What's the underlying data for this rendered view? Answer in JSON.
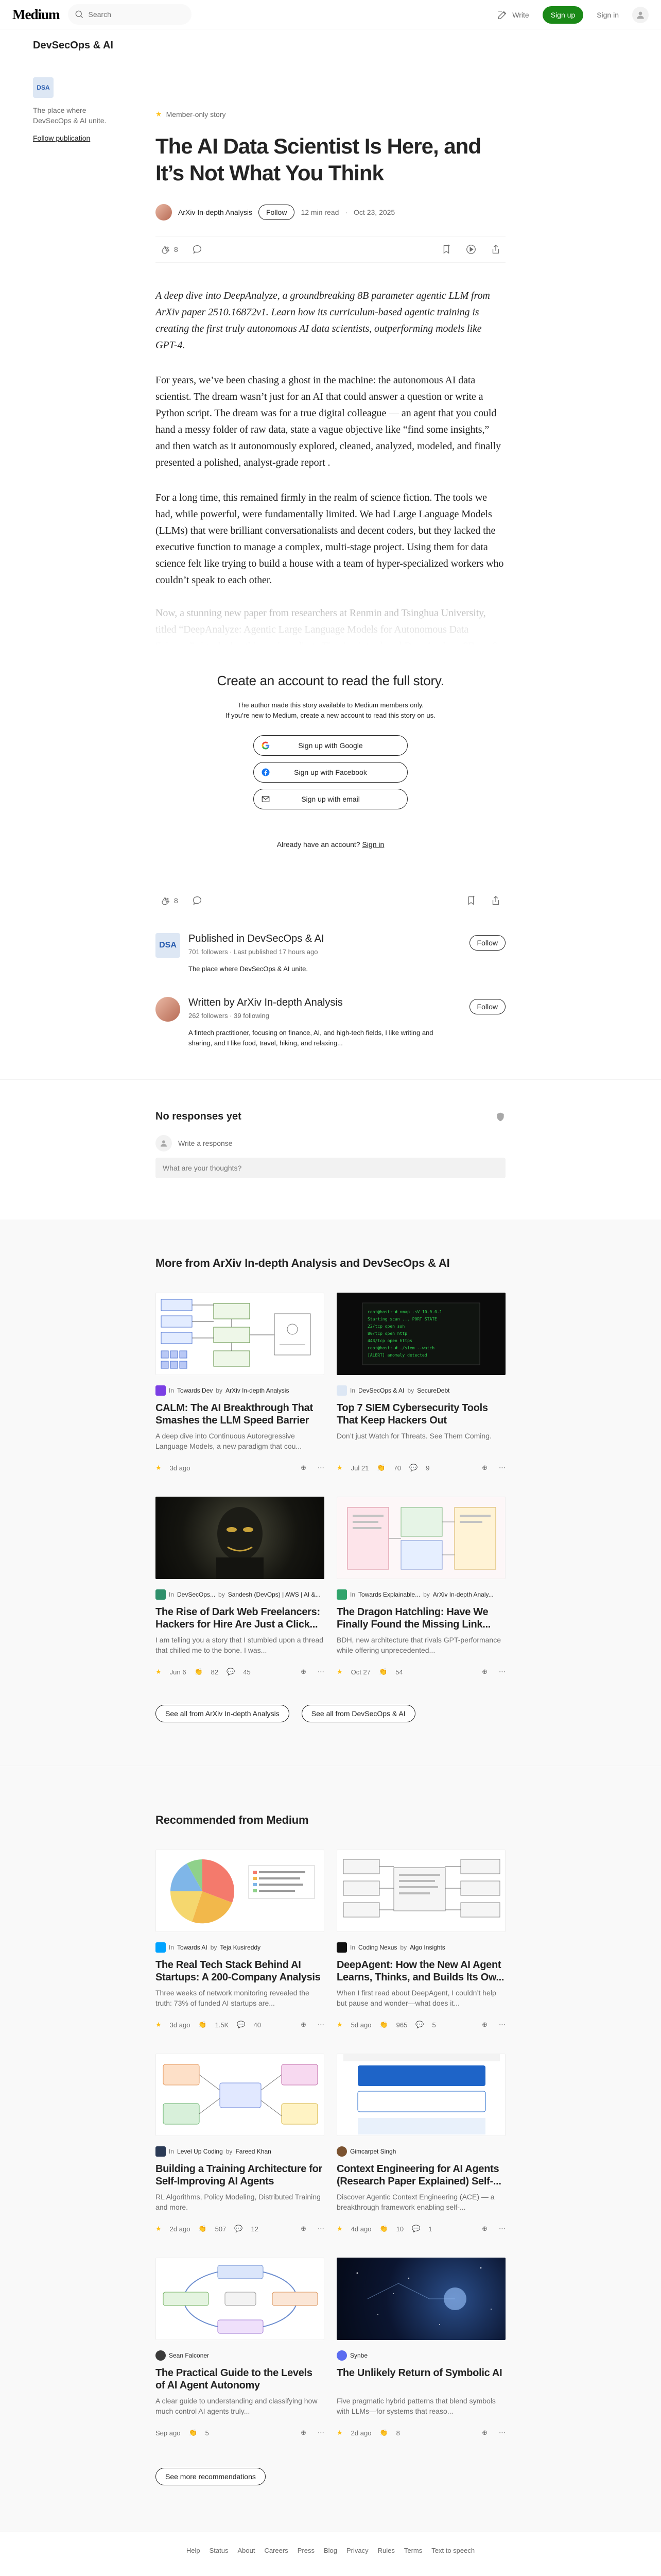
{
  "brand": {
    "logo": "Medium",
    "accent": "#1a8917"
  },
  "topbar": {
    "search_placeholder": "Search",
    "write_label": "Write",
    "signup_label": "Sign up",
    "signin_label": "Sign in"
  },
  "publication": {
    "name": "DevSecOps & AI",
    "icon_text": "DSA",
    "tagline": "The place where DevSecOps & AI unite.",
    "follow_link": "Follow publication"
  },
  "article": {
    "member_label": "Member-only story",
    "title": "The AI Data Scientist Is Here, and It’s Not What You Think",
    "author": "ArXiv In-depth Analysis",
    "follow_label": "Follow",
    "read_time": "12 min read",
    "date": "Oct 23, 2025",
    "claps": "8",
    "lede": "A deep dive into DeepAnalyze, a groundbreaking 8B parameter agentic LLM from ArXiv paper 2510.16872v1. Learn how its curriculum-based agentic training is creating the first truly autonomous AI data scientists, outperforming models like GPT-4.",
    "p1": "For years, we’ve been chasing a ghost in the machine: the autonomous AI data scientist. The dream wasn’t just for an AI that could answer a question or write a Python script. The dream was for a true digital colleague — an agent that you could hand a messy folder of raw data, state a vague objective like “find some insights,” and then watch as it autonomously explored, cleaned, analyzed, modeled, and finally presented a polished, analyst-grade report .",
    "p2": "For a long time, this remained firmly in the realm of science fiction. The tools we had, while powerful, were fundamentally limited. We had Large Language Models (LLMs) that were brilliant conversationalists and decent coders, but they lacked the executive function to manage a complex, multi-stage project. Using them for data science felt like trying to build a house with a team of hyper-specialized workers who couldn’t speak to each other.",
    "p3": "Now, a stunning new paper from researchers at Renmin and Tsinghua University, titled “DeepAnalyze: Agentic Large Language Models for Autonomous Data Science,” signals that this era is ending . They’ve introduced DeepAnalyze-8B, an 8 billion parameter model that isn’t just another assistant; it’s the first agentic LLM built for autonomous data science."
  },
  "paywall": {
    "title": "Create an account to read the full story.",
    "sub1": "The author made this story available to Medium members only.",
    "sub2": "If you’re new to Medium, create a new account to read this story on us.",
    "google": "Sign up with Google",
    "facebook": "Sign up with Facebook",
    "email": "Sign up with email",
    "have_account": "Already have an account?",
    "signin": "Sign in"
  },
  "bottom_actions": {
    "claps": "8"
  },
  "published_in": {
    "title": "Published in DevSecOps & AI",
    "meta": "701 followers · Last published 17 hours ago",
    "desc": "The place where DevSecOps & AI unite.",
    "follow_label": "Follow"
  },
  "written_by": {
    "title": "Written by ArXiv In-depth Analysis",
    "meta": "262 followers · 39 following",
    "desc": "A fintech practitioner, focusing on finance, AI, and high-tech fields, I like writing and sharing, and I like food, travel, hiking, and relaxing...",
    "follow_label": "Follow"
  },
  "responses": {
    "title": "No responses yet",
    "write_label": "Write a response",
    "placeholder": "What are your thoughts?"
  },
  "more_from": {
    "title": "More from ArXiv In-depth Analysis and DevSecOps & AI",
    "cards": [
      {
        "in_text": "In",
        "pub": "Towards Dev",
        "by": "by",
        "author": "ArXiv In-depth Analysis",
        "title": "CALM: The AI Breakthrough That Smashes the LLM Speed Barrier b...",
        "excerpt": "A deep dive into Continuous Autoregressive Language Models, a new paradigm that cou...",
        "date": "3d ago",
        "claps": "",
        "comments": "",
        "thumb": "diagram",
        "ava_color": "#7b3fe4"
      },
      {
        "in_text": "In",
        "pub": "DevSecOps & AI",
        "by": "by",
        "author": "SecureDebt",
        "title": "Top 7 SIEM Cybersecurity Tools That Keep Hackers Out",
        "excerpt": "Don’t just Watch for Threats. See Them Coming.",
        "date": "Jul 21",
        "claps": "70",
        "comments": "9",
        "thumb": "terminal",
        "ava_color": "#dde7f4"
      },
      {
        "in_text": "In",
        "pub": "DevSecOps...",
        "by": "by",
        "author": "Sandesh (DevOps) | AWS | AI &...",
        "title": "The Rise of Dark Web Freelancers: Hackers for Hire Are Just a Click...",
        "excerpt": "I am telling you a story that I stumbled upon a thread that chilled me to the bone. I was...",
        "date": "Jun 6",
        "claps": "82",
        "comments": "45",
        "thumb": "hacker",
        "ava_color": "#2f8f6b"
      },
      {
        "in_text": "In",
        "pub": "Towards Explainable...",
        "by": "by",
        "author": "ArXiv In-depth Analy...",
        "title": "The Dragon Hatchling: Have We Finally Found the Missing Link...",
        "excerpt": "BDH, new architecture that rivals GPT-performance while offering unprecedented...",
        "date": "Oct 27",
        "claps": "54",
        "comments": "",
        "thumb": "pinkdiagram",
        "ava_color": "#30a46c"
      }
    ],
    "see_all_1": "See all from ArXiv In-depth Analysis",
    "see_all_2": "See all from DevSecOps & AI"
  },
  "recommended": {
    "title": "Recommended from Medium",
    "cards": [
      {
        "in_text": "In",
        "pub": "Towards AI",
        "by": "by",
        "author": "Teja Kusireddy",
        "title": "The Real Tech Stack Behind AI Startups: A 200-Company Analysis",
        "excerpt": "Three weeks of network monitoring revealed the truth: 73% of funded AI startups are...",
        "date": "3d ago",
        "claps": "1.5K",
        "comments": "40",
        "thumb": "pie",
        "ava_color": "#00a3ff"
      },
      {
        "in_text": "In",
        "pub": "Coding Nexus",
        "by": "by",
        "author": "Algo Insights",
        "title": "DeepAgent: How the New AI Agent Learns, Thinks, and Builds Its Ow...",
        "excerpt": "When I first read about DeepAgent, I couldn’t help but pause and wonder—what does it...",
        "date": "5d ago",
        "claps": "965",
        "comments": "5",
        "thumb": "flow",
        "ava_color": "#111111"
      },
      {
        "in_text": "In",
        "pub": "Level Up Coding",
        "by": "by",
        "author": "Fareed Khan",
        "title": "Building a Training Architecture for Self-Improving AI Agents",
        "excerpt": "RL Algorithms, Policy Modeling, Distributed Training and more.",
        "date": "2d ago",
        "claps": "507",
        "comments": "12",
        "thumb": "colorflow",
        "ava_color": "#2b3a55"
      },
      {
        "in_text": "",
        "pub": "",
        "by": "",
        "author": "Gimcarpet Singh",
        "title": "Context Engineering for AI Agents (Research Paper Explained) Self-...",
        "excerpt": "Discover Agentic Context Engineering (ACE) — a breakthrough framework enabling self-...",
        "date": "4d ago",
        "claps": "10",
        "comments": "1",
        "thumb": "research",
        "ava_color": "#7a5230"
      },
      {
        "in_text": "",
        "pub": "",
        "by": "",
        "author": "Sean Falconer",
        "title": "The Practical Guide to the Levels of AI Agent Autonomy",
        "excerpt": "A clear guide to understanding and classifying how much control AI agents truly...",
        "date": "Sep ago",
        "claps": "5",
        "comments": "",
        "thumb": "loop",
        "ava_color": "#3a3a3a"
      },
      {
        "in_text": "",
        "pub": "",
        "by": "",
        "author": "Synbe",
        "title": "The Unlikely Return of Symbolic AI",
        "excerpt": "Five pragmatic hybrid patterns that blend symbols with LLMs—for systems that reaso...",
        "date": "2d ago",
        "claps": "8",
        "comments": "",
        "thumb": "space",
        "ava_color": "#5b6cf0"
      }
    ],
    "see_more": "See more recommendations"
  },
  "footer": [
    "Help",
    "Status",
    "About",
    "Careers",
    "Press",
    "Blog",
    "Privacy",
    "Rules",
    "Terms",
    "Text to speech"
  ]
}
